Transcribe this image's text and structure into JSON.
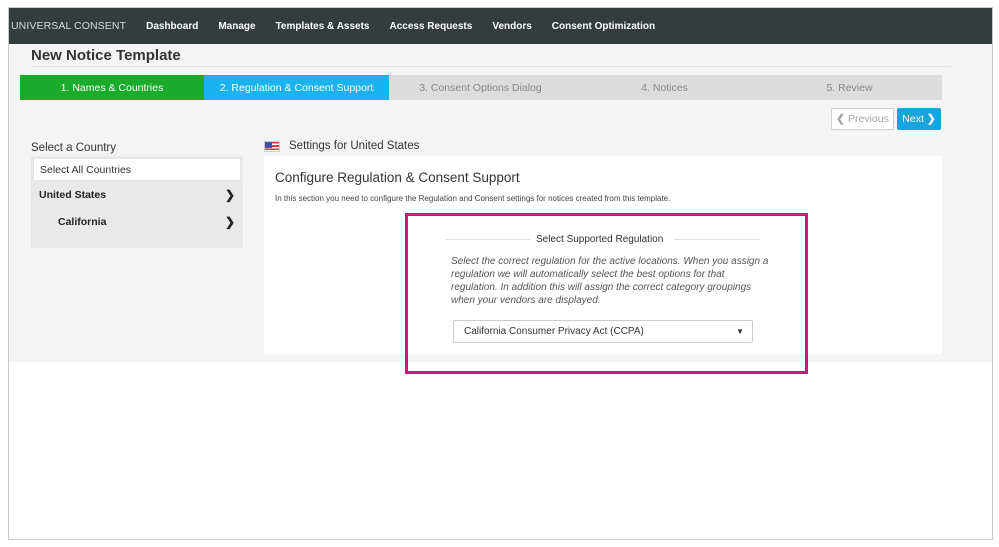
{
  "nav": {
    "brand": "UNIVERSAL CONSENT",
    "items": [
      "Dashboard",
      "Manage",
      "Templates & Assets",
      "Access Requests",
      "Vendors",
      "Consent Optimization"
    ]
  },
  "page": {
    "title": "New Notice Template"
  },
  "wizard": {
    "steps": [
      {
        "label": "1. Names & Countries",
        "state": "done"
      },
      {
        "label": "2. Regulation & Consent Support",
        "state": "active"
      },
      {
        "label": "3. Consent Options Dialog",
        "state": "todo"
      },
      {
        "label": "4. Notices",
        "state": "todo"
      },
      {
        "label": "5. Review",
        "state": "todo"
      }
    ],
    "prev_label": "Previous",
    "next_label": "Next"
  },
  "countries": {
    "header": "Select a Country",
    "select_all": "Select All Countries",
    "items": [
      {
        "label": "United States"
      },
      {
        "label": "California"
      }
    ]
  },
  "settings": {
    "header": "Settings for United States",
    "config_title": "Configure Regulation & Consent Support",
    "config_desc": "In this section you need to configure the Regulation and Consent settings for notices created from this template.",
    "regulation": {
      "label": "Select Supported Regulation",
      "help": "Select the correct regulation for the active locations. When you assign a regulation we will automatically select the best options for that regulation. In addition this will assign the correct category groupings when your vendors are displayed.",
      "selected": "California Consumer Privacy Act (CCPA)"
    }
  },
  "colors": {
    "nav_bg": "#343c3e",
    "step_done": "#1aab2b",
    "step_active": "#1ab3f0",
    "step_todo": "#dcdcdc",
    "next_button": "#1aa3dd",
    "highlight": "#c8197c"
  },
  "icons": {
    "prev": "chevron-left-icon",
    "next": "chevron-right-icon",
    "row": "chevron-right-icon",
    "flag": "us-flag-icon",
    "select": "caret-down-icon"
  }
}
